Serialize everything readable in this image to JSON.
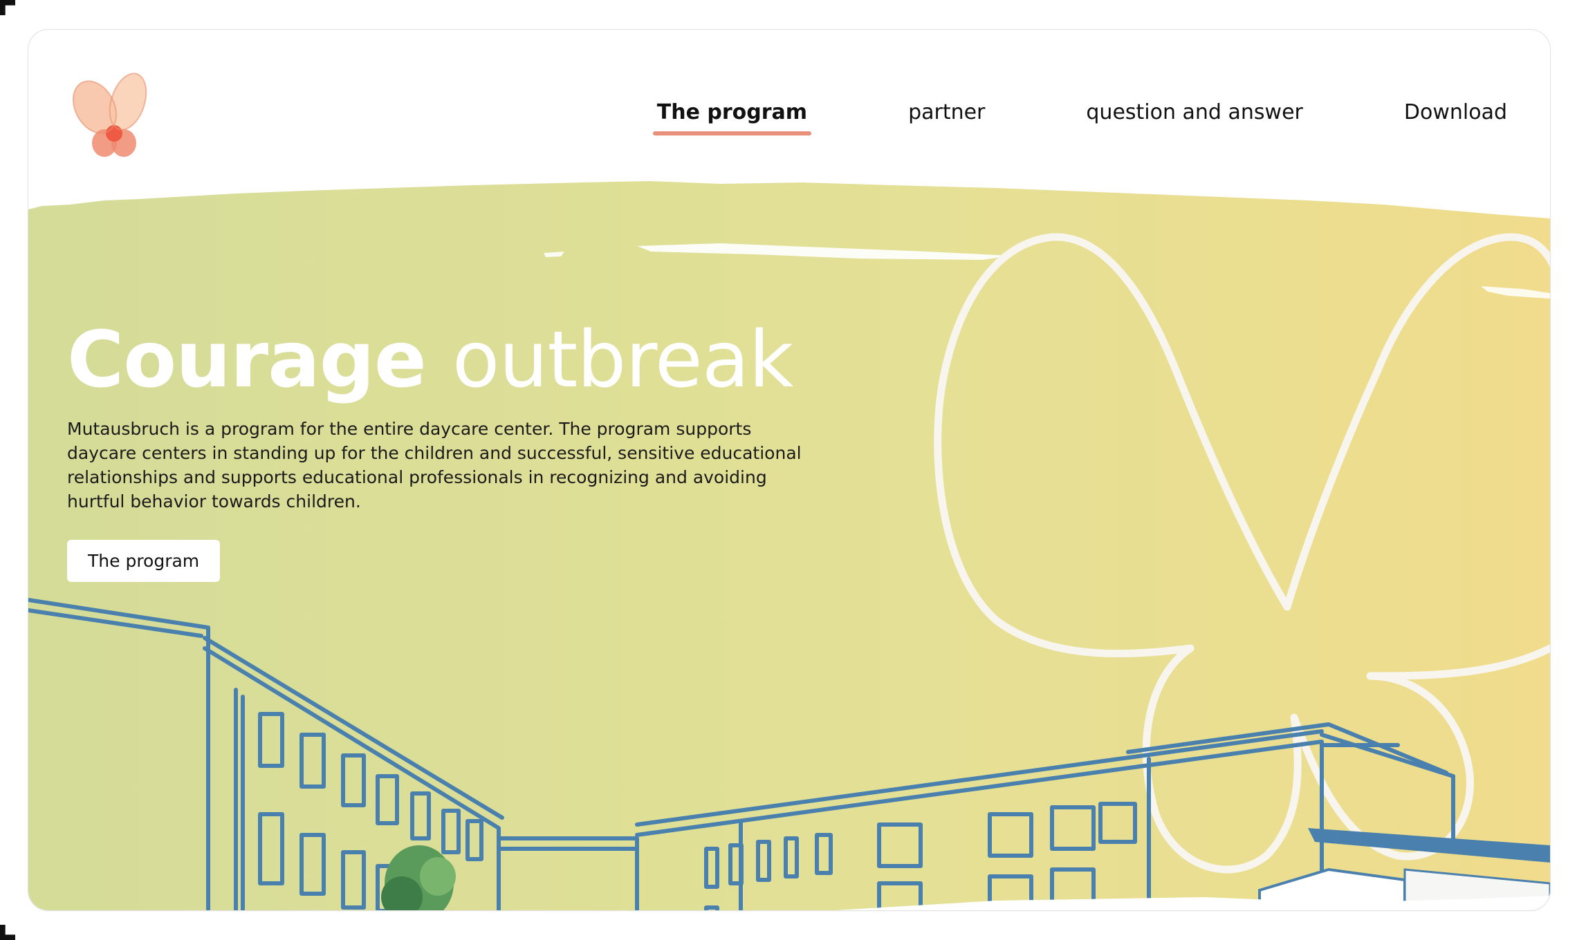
{
  "header": {
    "logo_icon": "butterfly-logo-icon",
    "nav": [
      {
        "label": "The program",
        "active": true
      },
      {
        "label": "partner",
        "active": false
      },
      {
        "label": "question and answer",
        "active": false
      },
      {
        "label": "Download",
        "active": false
      }
    ]
  },
  "hero": {
    "title_bold": "Courage",
    "title_light": "outbreak",
    "description": "Mutausbruch is a program for the entire daycare center. The program supports daycare centers in standing up for the children and successful, sensitive educational relationships and supports educational professionals in recognizing and avoiding hurtful behavior towards children.",
    "button_label": "The program",
    "illustration": "hand-drawn daycare building with butterfly outline",
    "colors": {
      "background_start": "#d4dc98",
      "background_end": "#f0dc8c",
      "lines": "#4a80ae",
      "accent": "#e8907a"
    }
  }
}
